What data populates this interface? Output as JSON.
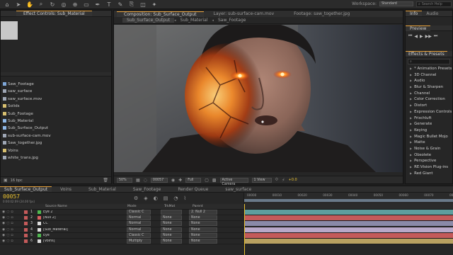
{
  "app": {
    "menubar": {
      "workspace_label": "Workspace:",
      "workspace_value": "Standard",
      "search_placeholder": "Search Help"
    }
  },
  "left_panel": {
    "tabs": [
      "Effect Controls: Sub_Material"
    ],
    "items": [
      {
        "label": "Saw_Footage",
        "color": "#7fa7d8"
      },
      {
        "label": "saw_surface",
        "color": "#9fa7b5"
      },
      {
        "label": "saw_surface.mov",
        "color": "#9fa7b5"
      },
      {
        "label": "Solids",
        "color": "#d8c070"
      },
      {
        "label": "Sub_Footage",
        "color": "#d8c070"
      },
      {
        "label": "Sub_Material",
        "color": "#8fb8e8"
      },
      {
        "label": "Sub_Surface_Output",
        "color": "#8fb8e8"
      },
      {
        "label": "sub-surface-cam.mov",
        "color": "#9fa7b5"
      },
      {
        "label": "Saw_together.jpg",
        "color": "#9fa7b5"
      },
      {
        "label": "Voins",
        "color": "#d8c070"
      },
      {
        "label": "white_trans.jpg",
        "color": "#9fa7b5"
      }
    ],
    "footer": "16 bpc"
  },
  "viewer": {
    "doc_tabs": [
      "Composition: Sub_Surface_Output",
      "Layer: sub-surface-cam.mov",
      "Footage: saw_together.jpg"
    ],
    "comp_tabs": [
      "Sub_Surface_Output",
      "Sub_Material",
      "Saw_Footage"
    ],
    "footer": {
      "zoom": "50%",
      "timecode": "00057",
      "quality": "Full",
      "camera": "Active Camera",
      "views": "1 View",
      "exposure": "+0.0"
    }
  },
  "right_panel": {
    "info_tab": "Info",
    "audio_tab": "Audio",
    "preview_tab": "Preview",
    "effects_tab": "Effects & Presets",
    "search_placeholder": "",
    "effects": [
      "* Animation Presets",
      "3D Channel",
      "Audio",
      "Blur & Sharpen",
      "Channel",
      "Color Correction",
      "Distort",
      "Expression Controls",
      "Frischluft",
      "Generate",
      "Keying",
      "Magic Bullet Mojo",
      "Matte",
      "Noise & Grain",
      "Obsolete",
      "Perspective",
      "RE:Vision Plug-ins",
      "Red Giant"
    ]
  },
  "timeline": {
    "tabs": [
      "Sub_Surface_Output",
      "Voins",
      "Sub_Material",
      "Saw_Footage",
      "Render Queue",
      "saw_surface"
    ],
    "timecode": "00057",
    "timecode_sub": "0:00:02:09 (24.00 fps)",
    "columns": {
      "source_name": "Source Name",
      "mode": "Mode",
      "trkmat": "TrkMat",
      "parent": "Parent"
    },
    "layers": [
      {
        "num": "1",
        "name": "Eye 2",
        "color": "#4fb84f",
        "mode": "Classic C",
        "trk": "",
        "parent": "2. Null 2",
        "bar": "#5e9e9e",
        "bar_start": 0.0,
        "bar_end": 1.0
      },
      {
        "num": "2",
        "name": "[Null 2]",
        "color": "#d86060",
        "mode": "Normal",
        "trk": "None",
        "parent": "None",
        "bar": "#c45a5a",
        "bar_start": 0.0,
        "bar_end": 1.0
      },
      {
        "num": "3",
        "name": "CC",
        "color": "#dddddd",
        "mode": "Normal",
        "trk": "None",
        "parent": "None",
        "bar": "#8a8aa8",
        "bar_start": 0.0,
        "bar_end": 1.0
      },
      {
        "num": "4",
        "name": "[Sub_Material]",
        "color": "#dddddd",
        "mode": "Normal",
        "trk": "None",
        "parent": "None",
        "bar": "#b8a8c8",
        "bar_start": 0.0,
        "bar_end": 1.0
      },
      {
        "num": "5",
        "name": "Eye",
        "color": "#4fb84f",
        "mode": "Classic C",
        "trk": "None",
        "parent": "None",
        "bar": "#c45a5a",
        "bar_start": 0.0,
        "bar_end": 1.0
      },
      {
        "num": "6",
        "name": "[Voins]",
        "color": "#dddddd",
        "mode": "Multiply",
        "trk": "None",
        "parent": "None",
        "bar": "#b8a060",
        "bar_start": 0.0,
        "bar_end": 1.0
      }
    ],
    "ruler": [
      "00000",
      "00010",
      "00020",
      "00030",
      "00040",
      "00050",
      "00060",
      "00070",
      "00080"
    ]
  },
  "colors": {
    "accent": "#e8a23c",
    "timecode": "#e8c030",
    "panel": "#262626",
    "background": "#1e1e1e"
  }
}
